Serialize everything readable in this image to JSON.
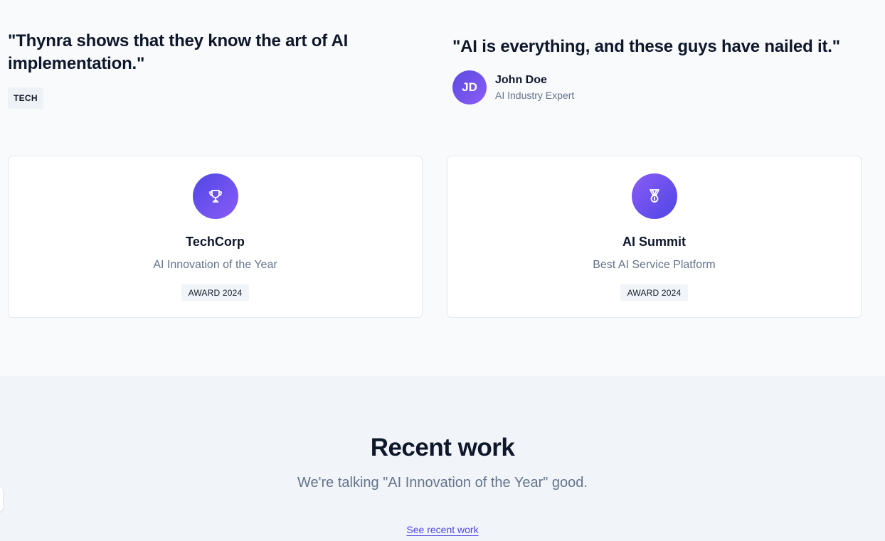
{
  "testimonials": [
    {
      "quote": "\"Thynra shows that they know the art of AI implementation.\"",
      "tag": "TECH"
    },
    {
      "quote": "\"AI is everything, and these guys have nailed it.\"",
      "author": {
        "initials": "JD",
        "name": "John Doe",
        "role": "AI Industry Expert"
      }
    }
  ],
  "awards": [
    {
      "icon": "trophy-icon",
      "title": "TechCorp",
      "subtitle": "AI Innovation of the Year",
      "badge": "AWARD 2024"
    },
    {
      "icon": "medal-icon",
      "title": "AI Summit",
      "subtitle": "Best AI Service Platform",
      "badge": "AWARD 2024"
    }
  ],
  "recent_work": {
    "title": "Recent work",
    "subtitle": "We're talking \"AI Innovation of the Year\" good.",
    "link_label": "See recent work"
  },
  "colors": {
    "accent": "#4f46e5",
    "accent_secondary": "#8b5cf6",
    "text_primary": "#0f172a",
    "text_muted": "#64748b",
    "page_bg": "#f8fafc",
    "section_bg": "#f1f4f9"
  }
}
